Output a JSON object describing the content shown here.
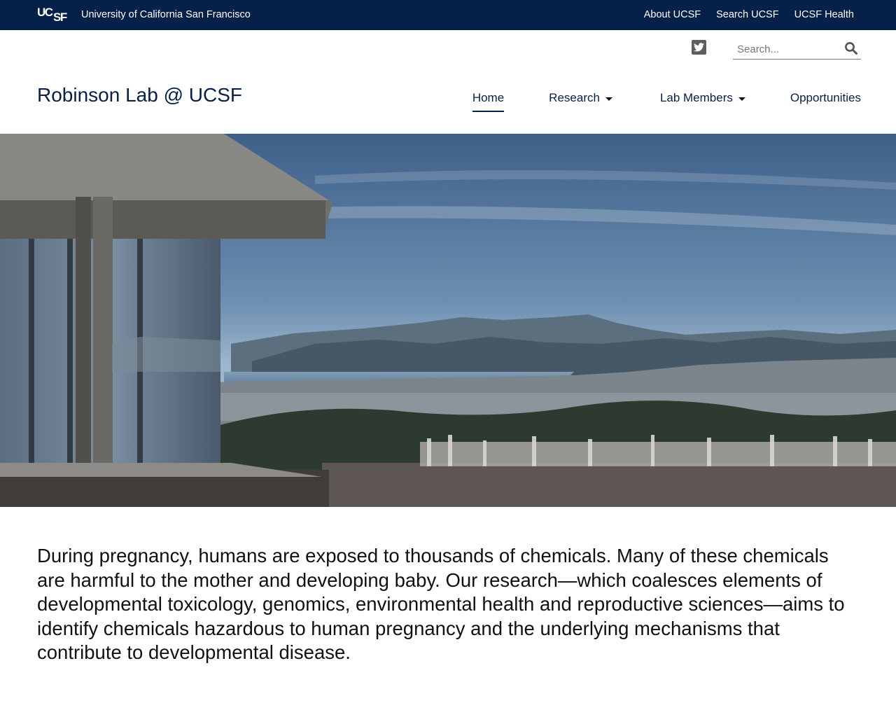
{
  "topbar": {
    "logo_text_top": "UC",
    "logo_text_bottom": "SF",
    "university_name": "University of California San Francisco",
    "links": [
      "About UCSF",
      "Search UCSF",
      "UCSF Health"
    ]
  },
  "search": {
    "placeholder": "Search...",
    "icon": "search-icon"
  },
  "social": {
    "icon": "twitter-icon"
  },
  "site_title": "Robinson Lab @ UCSF",
  "nav": {
    "items": [
      {
        "label": "Home",
        "active": true,
        "dropdown": false
      },
      {
        "label": "Research",
        "active": false,
        "dropdown": true
      },
      {
        "label": "Lab Members",
        "active": false,
        "dropdown": true
      },
      {
        "label": "Opportunities",
        "active": false,
        "dropdown": false
      }
    ]
  },
  "intro": "During pregnancy, humans are exposed to thousands of chemicals. Many of these chemicals are harmful to the mother and developing baby. Our research—which coalesces elements of developmental toxicology, genomics, environmental health and reproductive sciences—aims to identify chemicals hazardous to human pregnancy and the underlying mechanisms that contribute to developmental disease.",
  "colors": {
    "ucsf_navy": "#052049",
    "text": "#111111"
  }
}
